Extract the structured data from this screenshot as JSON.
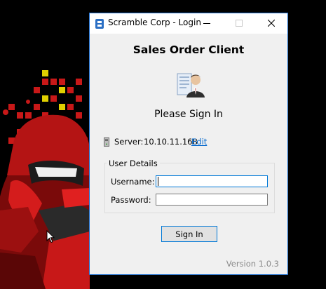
{
  "window": {
    "title": "Scramble Corp - Login",
    "accent_color": "#0078d7"
  },
  "titlebar_buttons": [
    "minimize",
    "maximize",
    "close"
  ],
  "main": {
    "heading": "Sales Order Client",
    "signin_heading": "Please Sign In",
    "user_icon": "user-with-document-icon"
  },
  "server": {
    "label": "Server:",
    "value": "10.10.11.168",
    "edit_label": "Edit",
    "icon": "server-tower-icon"
  },
  "user_details": {
    "legend": "User Details",
    "username_label": "Username:",
    "username_value": "",
    "password_label": "Password:",
    "password_value": ""
  },
  "signin_button_label": "Sign In",
  "version_text": "Version 1.0.3",
  "wallpaper": "red-ninja-character-icon"
}
